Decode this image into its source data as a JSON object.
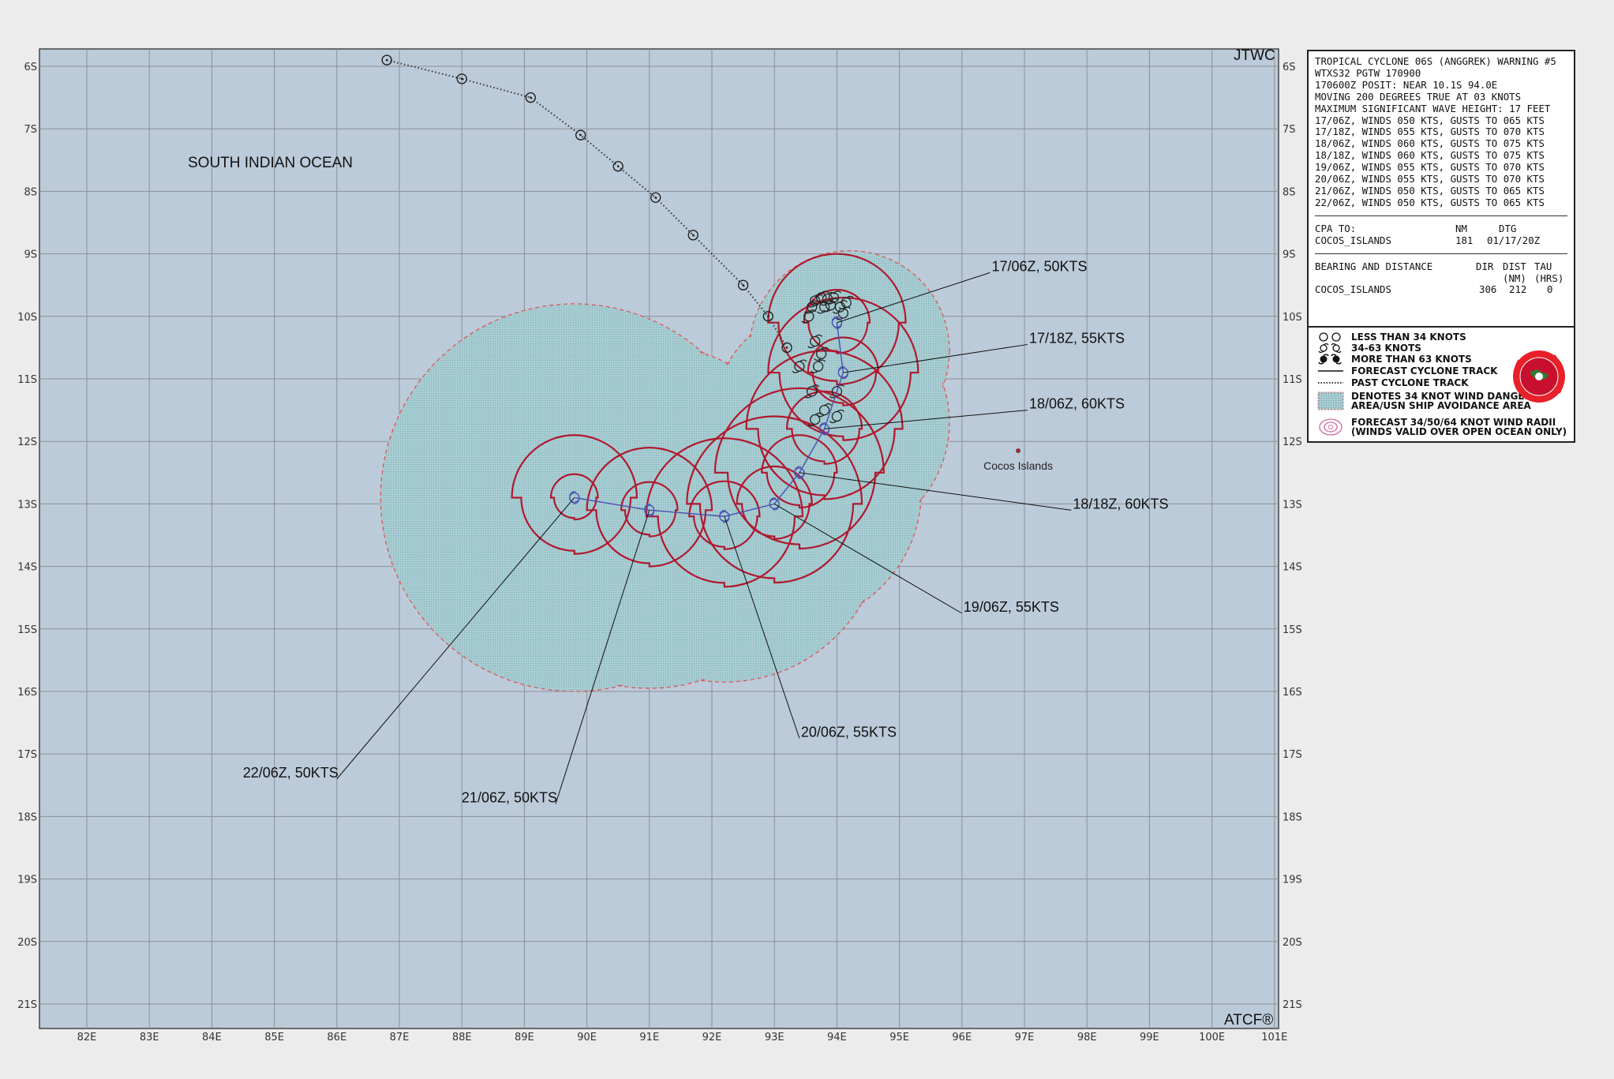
{
  "header": {
    "agency": "JTWC",
    "software": "ATCF®"
  },
  "map": {
    "ocean_label": "SOUTH INDIAN OCEAN",
    "island_label": "Cocos Islands",
    "lon_labels": [
      "82E",
      "83E",
      "84E",
      "85E",
      "86E",
      "87E",
      "88E",
      "89E",
      "90E",
      "91E",
      "92E",
      "93E",
      "94E",
      "95E",
      "96E",
      "97E",
      "98E",
      "99E",
      "100E",
      "101E"
    ],
    "lat_labels": [
      "6S",
      "7S",
      "8S",
      "9S",
      "10S",
      "11S",
      "12S",
      "13S",
      "14S",
      "15S",
      "16S",
      "17S",
      "18S",
      "19S",
      "20S",
      "21S"
    ],
    "lon_range": [
      81.6,
      101.0
    ],
    "lat_range": [
      -5.75,
      -21.5
    ],
    "island": {
      "lon": 96.9,
      "lat": -12.15
    },
    "colors": {
      "background": "#bccbd9",
      "grid": "#888888",
      "danger_area": "#9fc6cb",
      "danger_outline": "#e05555",
      "wind_radii": "#b0182e",
      "forecast_track": "#4a4fb0",
      "past_track": "#333333"
    },
    "past_track": [
      [
        86.8,
        -5.9
      ],
      [
        88.0,
        -6.2
      ],
      [
        89.1,
        -6.5
      ],
      [
        89.9,
        -7.1
      ],
      [
        90.5,
        -7.6
      ],
      [
        91.1,
        -8.1
      ],
      [
        91.7,
        -8.7
      ],
      [
        92.5,
        -9.5
      ],
      [
        92.9,
        -10.0
      ],
      [
        93.2,
        -10.5
      ]
    ],
    "forecast_track": [
      [
        94.0,
        -10.1
      ],
      [
        94.1,
        -10.9
      ],
      [
        93.8,
        -11.8
      ],
      [
        93.4,
        -12.5
      ],
      [
        93.0,
        -13.0
      ],
      [
        92.2,
        -13.2
      ],
      [
        91.0,
        -13.1
      ],
      [
        89.8,
        -12.9
      ]
    ],
    "forecast_points": [
      {
        "label": "17/06Z,  50KTS",
        "lon": 94.0,
        "lat": -10.1,
        "text_lon": 96.45,
        "text_lat": -9.3,
        "r34": 1.1,
        "r50": 0.7
      },
      {
        "label": "17/18Z,  55KTS",
        "lon": 94.1,
        "lat": -10.9,
        "text_lon": 97.05,
        "text_lon2": 0,
        "text_lat": -10.45,
        "r34": 1.2,
        "r50": 0.75
      },
      {
        "label": "18/06Z,  60KTS",
        "lon": 93.8,
        "lat": -11.8,
        "text_lon": 97.05,
        "text_lat": -11.5,
        "r34": 1.25,
        "r50": 0.8
      },
      {
        "label": "18/18Z,  60KTS",
        "lon": 93.4,
        "lat": -12.5,
        "text_lon": 97.75,
        "text_lat": -13.1,
        "r34": 1.35,
        "r50": 0.8
      },
      {
        "label": "19/06Z,  55KTS",
        "lon": 93.0,
        "lat": -13.0,
        "text_lon": 96.0,
        "text_lat": -14.75,
        "r34": 1.4,
        "r50": 0.8
      },
      {
        "label": "20/06Z,  55KTS",
        "lon": 92.2,
        "lat": -13.2,
        "text_lon": 93.4,
        "text_lat": -16.75,
        "r34": 1.25,
        "r50": 0.75
      },
      {
        "label": "21/06Z,  50KTS",
        "lon": 91.0,
        "lat": -13.1,
        "text_lon": 89.5,
        "text_lat": -17.8,
        "r34": 1.0,
        "r50": 0.6
      },
      {
        "label": "22/06Z,  50KTS",
        "lon": 89.8,
        "lat": -12.9,
        "text_lon": 86.0,
        "text_lat": -17.4,
        "r34": 1.0,
        "r50": 0.5
      }
    ]
  },
  "info": {
    "lines": [
      "TROPICAL CYCLONE 06S (ANGGREK) WARNING #5",
      "WTXS32 PGTW 170900",
      "170600Z POSIT: NEAR 10.1S 94.0E",
      "MOVING 200 DEGREES TRUE AT 03 KNOTS",
      "MAXIMUM SIGNIFICANT WAVE HEIGHT: 17 FEET",
      "17/06Z, WINDS 050 KTS, GUSTS TO 065 KTS",
      "17/18Z, WINDS 055 KTS, GUSTS TO 070 KTS",
      "18/06Z, WINDS 060 KTS, GUSTS TO 075 KTS",
      "18/18Z, WINDS 060 KTS, GUSTS TO 075 KTS",
      "19/06Z, WINDS 055 KTS, GUSTS TO 070 KTS",
      "20/06Z, WINDS 055 KTS, GUSTS TO 070 KTS",
      "21/06Z, WINDS 050 KTS, GUSTS TO 065 KTS",
      "22/06Z, WINDS 050 KTS, GUSTS TO 065 KTS"
    ],
    "cpa": {
      "heading": "CPA TO:",
      "nm_header": "NM",
      "dtg_header": "DTG",
      "station": "COCOS_ISLANDS",
      "nm": "181",
      "dtg": "01/17/20Z"
    },
    "bearing": {
      "heading": "BEARING AND DISTANCE",
      "dir_header": "DIR",
      "dist_header": "DIST",
      "tau_header": "TAU",
      "dist_unit": "(NM)",
      "tau_unit": "(HRS)",
      "station": "COCOS_ISLANDS",
      "dir": "306",
      "dist": "212",
      "tau": "0"
    }
  },
  "legend": {
    "items": [
      "LESS THAN 34 KNOTS",
      "34-63 KNOTS",
      "MORE THAN 63 KNOTS",
      "FORECAST CYCLONE TRACK",
      "PAST CYCLONE TRACK",
      "DENOTES 34 KNOT WIND DANGER",
      "AREA/USN SHIP AVOIDANCE AREA",
      "FORECAST 34/50/64 KNOT WIND RADII",
      "(WINDS VALID OVER OPEN OCEAN ONLY)"
    ],
    "logo_icon": "jtwc-seal-icon"
  }
}
